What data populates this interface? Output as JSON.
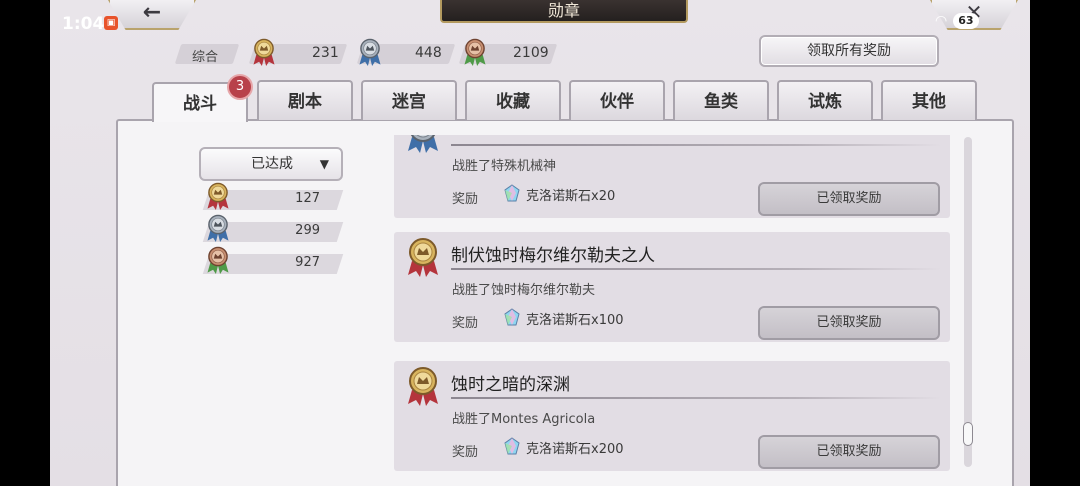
{
  "status": {
    "time": "1:04",
    "battery": "63"
  },
  "header": {
    "title": "勋章",
    "back_icon": "arrow-left-icon",
    "close_icon": "close-icon"
  },
  "summary": {
    "label": "综合",
    "gold": "231",
    "silver": "448",
    "bronze": "2109",
    "claim_all": "领取所有奖励"
  },
  "tabs": [
    {
      "label": "战斗",
      "active": true,
      "badge": "3"
    },
    {
      "label": "剧本"
    },
    {
      "label": "迷宫"
    },
    {
      "label": "收藏"
    },
    {
      "label": "伙伴"
    },
    {
      "label": "鱼类"
    },
    {
      "label": "试炼"
    },
    {
      "label": "其他"
    }
  ],
  "filter": {
    "selected": "已达成"
  },
  "counts": {
    "gold": "127",
    "silver": "299",
    "bronze": "927"
  },
  "achievements": [
    {
      "title": "",
      "desc": "战胜了特殊机械神",
      "reward_label": "奖励",
      "reward": "克洛诺斯石x20",
      "status": "已领取奖励"
    },
    {
      "title": "制伏蚀时梅尔维尔勒夫之人",
      "desc": "战胜了蚀时梅尔维尔勒夫",
      "reward_label": "奖励",
      "reward": "克洛诺斯石x100",
      "status": "已领取奖励"
    },
    {
      "title": "蚀时之暗的深渊",
      "desc": "战胜了Montes Agricola",
      "reward_label": "奖励",
      "reward": "克洛诺斯石x200",
      "status": "已领取奖励"
    }
  ],
  "colors": {
    "gold": "#c9a24a",
    "silver": "#8f9aa8",
    "bronze": "#b07a5a",
    "badge": "#b8414a"
  }
}
